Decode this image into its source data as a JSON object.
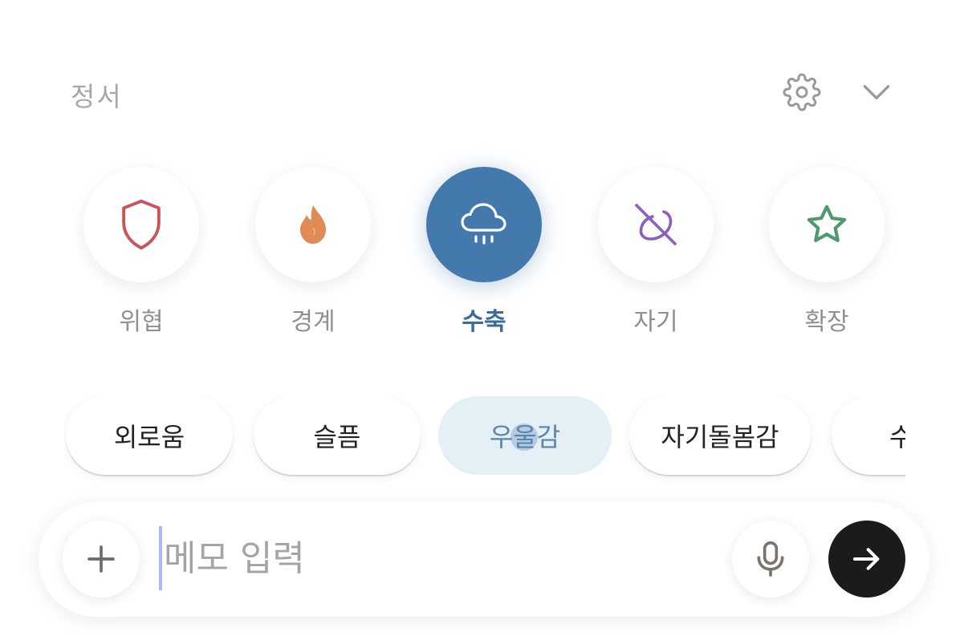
{
  "header": {
    "title": "정서",
    "icons": [
      "gear-icon",
      "chevron-down-icon"
    ]
  },
  "categories": [
    {
      "label": "위협",
      "icon": "shield-icon",
      "color": "#c9555a",
      "active": false
    },
    {
      "label": "경계",
      "icon": "flame-icon",
      "color": "#e08a55",
      "active": false
    },
    {
      "label": "수축",
      "icon": "rain-cloud-icon",
      "color": "#4479ad",
      "active": true
    },
    {
      "label": "자기",
      "icon": "self-slash-icon",
      "color": "#8a5fc0",
      "active": false
    },
    {
      "label": "확장",
      "icon": "star-icon",
      "color": "#4e9a6e",
      "active": false
    }
  ],
  "chips": [
    {
      "label": "외로움",
      "active": false
    },
    {
      "label": "슬픔",
      "active": false
    },
    {
      "label": "우울감",
      "active": true
    },
    {
      "label": "자기돌봄감",
      "active": false
    },
    {
      "label": "수",
      "active": false
    }
  ],
  "input": {
    "placeholder": "메모 입력",
    "value": "",
    "icons": [
      "plus-icon",
      "microphone-icon",
      "arrow-right-icon"
    ]
  },
  "colors": {
    "accent": "#4479ad",
    "send_button": "#1d1b19",
    "chip_active_bg": "#e4eff6"
  }
}
